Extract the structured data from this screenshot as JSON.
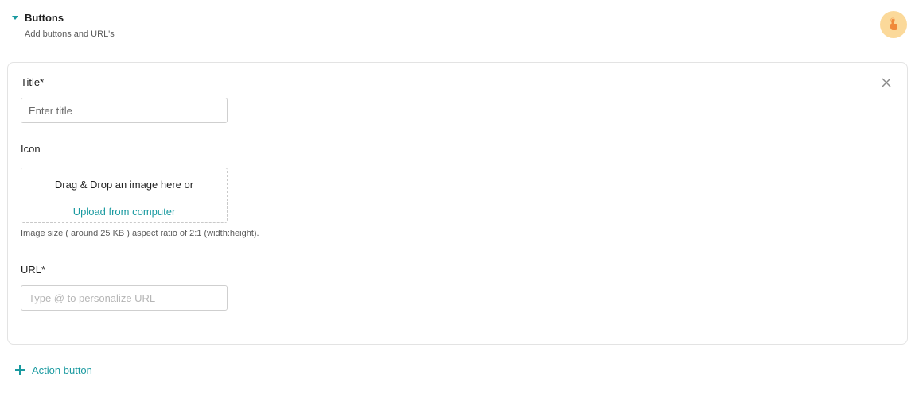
{
  "section": {
    "title": "Buttons",
    "subtitle": "Add buttons and URL's",
    "badge_icon": "pointer-hand-icon",
    "accent_color": "#1a9aa0",
    "badge_color": "#fbd99a"
  },
  "form": {
    "title_label": "Title",
    "title_required": "*",
    "title_placeholder": "Enter title",
    "icon_label": "Icon",
    "dropzone_text": "Drag & Drop an image here or",
    "upload_link": "Upload from computer",
    "image_hint": "Image size ( around 25 KB ) aspect ratio of 2:1 (width:height).",
    "url_label": "URL",
    "url_required": "*",
    "url_placeholder": "Type @ to personalize URL"
  },
  "actions": {
    "add_action_label": "Action button"
  }
}
